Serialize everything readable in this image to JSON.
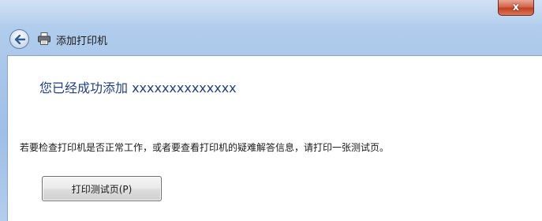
{
  "window": {
    "title": "添加打印机",
    "close_glyph": "x"
  },
  "icons": {
    "back": "back-arrow-icon",
    "printer": "printer-icon"
  },
  "main": {
    "heading": "您已经成功添加 xxxxxxxxxxxxxx",
    "instruction": "若要检查打印机是否正常工作，或者要查看打印机的疑难解答信息，请打印一张测试页。",
    "test_button_label": "打印测试页(P)"
  },
  "colors": {
    "heading": "#1e3f8a",
    "frame": "#a9c7ea",
    "close_button": "#c2401f"
  }
}
